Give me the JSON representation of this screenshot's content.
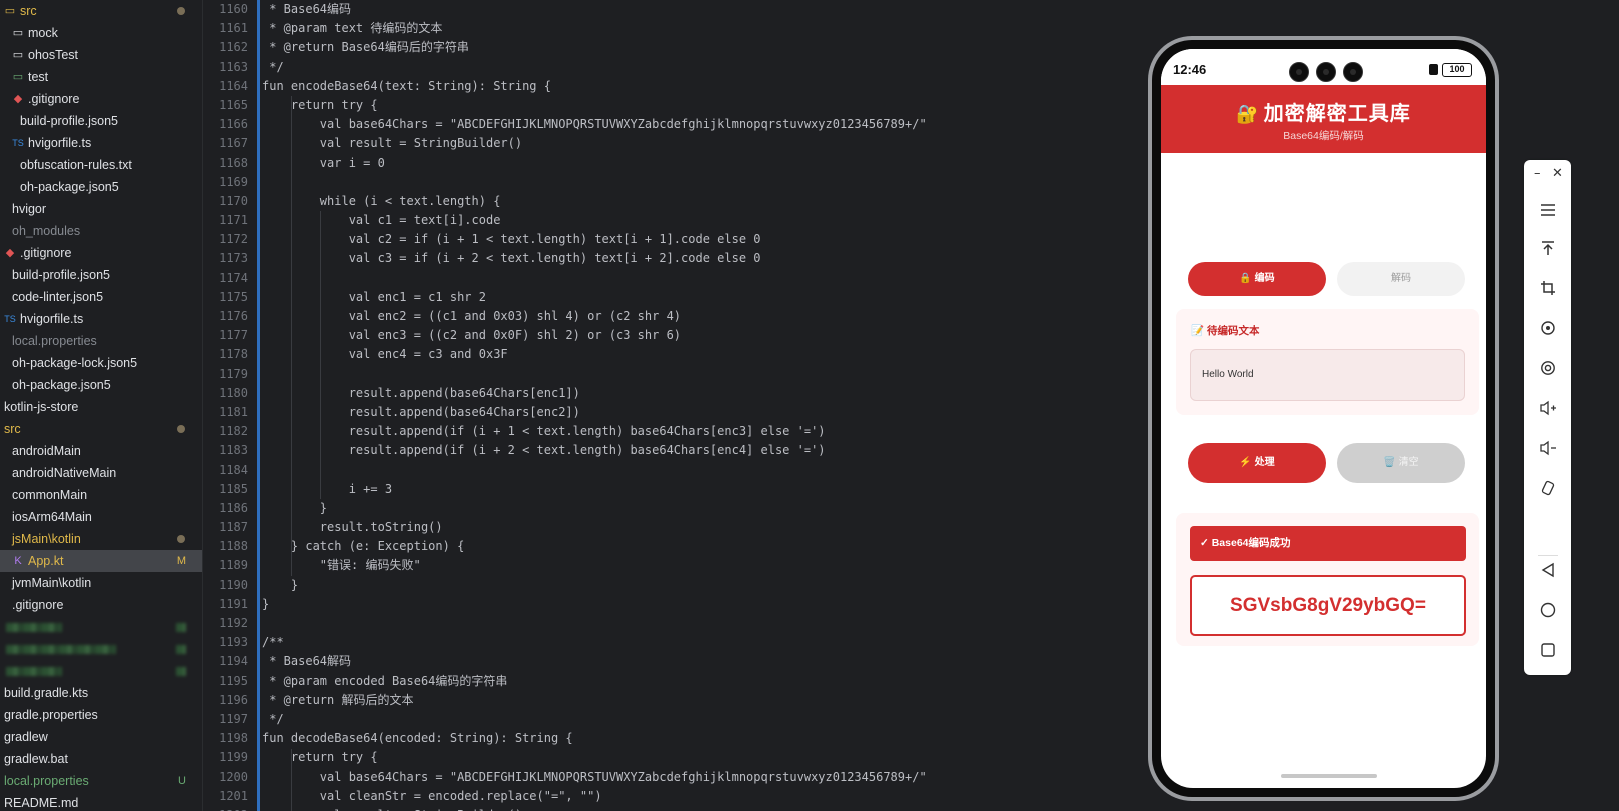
{
  "project_tree": [
    {
      "label": "src",
      "icon": "src-folder-icon",
      "indent": 0,
      "color": "yellow",
      "status": "dot"
    },
    {
      "label": "mock",
      "icon": "folder-icon",
      "indent": 1,
      "color": "",
      "status": ""
    },
    {
      "label": "ohosTest",
      "icon": "folder-icon",
      "indent": 1,
      "color": "",
      "status": ""
    },
    {
      "label": "test",
      "icon": "test-folder-icon",
      "indent": 1,
      "color": "",
      "status": ""
    },
    {
      "label": ".gitignore",
      "icon": "git-icon",
      "indent": 1,
      "color": "",
      "status": ""
    },
    {
      "label": "build-profile.json5",
      "icon": "",
      "indent": 1,
      "color": "",
      "status": ""
    },
    {
      "label": "hvigorfile.ts",
      "icon": "ts-icon",
      "indent": 1,
      "color": "",
      "status": ""
    },
    {
      "label": "obfuscation-rules.txt",
      "icon": "",
      "indent": 1,
      "color": "",
      "status": ""
    },
    {
      "label": "oh-package.json5",
      "icon": "",
      "indent": 1,
      "color": "",
      "status": ""
    },
    {
      "label": "hvigor",
      "icon": "",
      "indent": 0,
      "color": "",
      "status": ""
    },
    {
      "label": "oh_modules",
      "icon": "",
      "indent": 0,
      "color": "grey",
      "status": ""
    },
    {
      "label": ".gitignore",
      "icon": "git-icon",
      "indent": 0,
      "color": "",
      "status": ""
    },
    {
      "label": "build-profile.json5",
      "icon": "",
      "indent": 0,
      "color": "",
      "status": ""
    },
    {
      "label": "code-linter.json5",
      "icon": "",
      "indent": 0,
      "color": "",
      "status": ""
    },
    {
      "label": "hvigorfile.ts",
      "icon": "ts-icon",
      "indent": 0,
      "color": "",
      "status": ""
    },
    {
      "label": "local.properties",
      "icon": "",
      "indent": 0,
      "color": "grey",
      "status": ""
    },
    {
      "label": "oh-package-lock.json5",
      "icon": "",
      "indent": 0,
      "color": "",
      "status": ""
    },
    {
      "label": "oh-package.json5",
      "icon": "",
      "indent": 0,
      "color": "",
      "status": ""
    },
    {
      "label": "kotlin-js-store",
      "icon": "",
      "indent": -1,
      "color": "",
      "status": ""
    },
    {
      "label": "src",
      "icon": "",
      "indent": -1,
      "color": "yellow",
      "status": "dot"
    },
    {
      "label": "androidMain",
      "icon": "",
      "indent": 0,
      "color": "",
      "status": ""
    },
    {
      "label": "androidNativeMain",
      "icon": "",
      "indent": 0,
      "color": "",
      "status": ""
    },
    {
      "label": "commonMain",
      "icon": "",
      "indent": 0,
      "color": "",
      "status": ""
    },
    {
      "label": "iosArm64Main",
      "icon": "",
      "indent": 0,
      "color": "",
      "status": ""
    },
    {
      "label": "jsMain\\kotlin",
      "icon": "",
      "indent": 0,
      "color": "yellow",
      "status": "dot"
    },
    {
      "label": "App.kt",
      "icon": "kotlin-file-icon",
      "indent": 1,
      "color": "yellow",
      "status": "M",
      "selected": true
    },
    {
      "label": "jvmMain\\kotlin",
      "icon": "",
      "indent": 0,
      "color": "",
      "status": ""
    },
    {
      "label": ".gitignore",
      "icon": "",
      "indent": 0,
      "color": "",
      "status": ""
    },
    {
      "label": "",
      "icon": "",
      "indent": 0,
      "color": "",
      "status": "",
      "blurred": true
    },
    {
      "label": "",
      "icon": "",
      "indent": 0,
      "color": "",
      "status": "",
      "blurred": true
    },
    {
      "label": "",
      "icon": "",
      "indent": 0,
      "color": "",
      "status": "",
      "blurred": true
    },
    {
      "label": "build.gradle.kts",
      "icon": "",
      "indent": -1,
      "color": "",
      "status": ""
    },
    {
      "label": "gradle.properties",
      "icon": "",
      "indent": -1,
      "color": "",
      "status": ""
    },
    {
      "label": "gradlew",
      "icon": "",
      "indent": -1,
      "color": "",
      "status": ""
    },
    {
      "label": "gradlew.bat",
      "icon": "",
      "indent": -1,
      "color": "",
      "status": ""
    },
    {
      "label": "local.properties",
      "icon": "",
      "indent": -1,
      "color": "green",
      "status": "U"
    },
    {
      "label": "README.md",
      "icon": "",
      "indent": -1,
      "color": "",
      "status": ""
    }
  ],
  "editor": {
    "first_line_number": 1160,
    "lines": [
      " * Base64编码",
      " * @param text 待编码的文本",
      " * @return Base64编码后的字符串",
      " */",
      "fun encodeBase64(text: String): String {",
      "    return try {",
      "        val base64Chars = \"ABCDEFGHIJKLMNOPQRSTUVWXYZabcdefghijklmnopqrstuvwxyz0123456789+/\"",
      "        val result = StringBuilder()",
      "        var i = 0",
      "",
      "        while (i < text.length) {",
      "            val c1 = text[i].code",
      "            val c2 = if (i + 1 < text.length) text[i + 1].code else 0",
      "            val c3 = if (i + 2 < text.length) text[i + 2].code else 0",
      "",
      "            val enc1 = c1 shr 2",
      "            val enc2 = ((c1 and 0x03) shl 4) or (c2 shr 4)",
      "            val enc3 = ((c2 and 0x0F) shl 2) or (c3 shr 6)",
      "            val enc4 = c3 and 0x3F",
      "",
      "            result.append(base64Chars[enc1])",
      "            result.append(base64Chars[enc2])",
      "            result.append(if (i + 1 < text.length) base64Chars[enc3] else '=')",
      "            result.append(if (i + 2 < text.length) base64Chars[enc4] else '=')",
      "",
      "            i += 3",
      "        }",
      "        result.toString()",
      "    } catch (e: Exception) {",
      "        \"错误: 编码失败\"",
      "    }",
      "}",
      "",
      "/**",
      " * Base64解码",
      " * @param encoded Base64编码的字符串",
      " * @return 解码后的文本",
      " */",
      "fun decodeBase64(encoded: String): String {",
      "    return try {",
      "        val base64Chars = \"ABCDEFGHIJKLMNOPQRSTUVWXYZabcdefghijklmnopqrstuvwxyz0123456789+/\"",
      "        val cleanStr = encoded.replace(\"=\", \"\")",
      "        val result = StringBuilder()"
    ]
  },
  "phone": {
    "status_time": "12:46",
    "battery": "100",
    "app_title": "加密解密工具库",
    "app_subtitle": "Base64编码/解码",
    "mode_tabs": {
      "encode": "🔒 编码",
      "decode": "解码"
    },
    "input_label": "📝 待编码文本",
    "input_value": "Hello World",
    "process_button": "⚡ 处理",
    "clear_button": "🗑️ 清空",
    "success_message": "✓ Base64编码成功",
    "result_value": "SGVsbG8gV29ybGQ="
  },
  "colors": {
    "accent": "#d32f2f",
    "editor_bg": "#1e1f22",
    "modified_file": "#e0b94a",
    "untracked_file": "#6aab73"
  }
}
